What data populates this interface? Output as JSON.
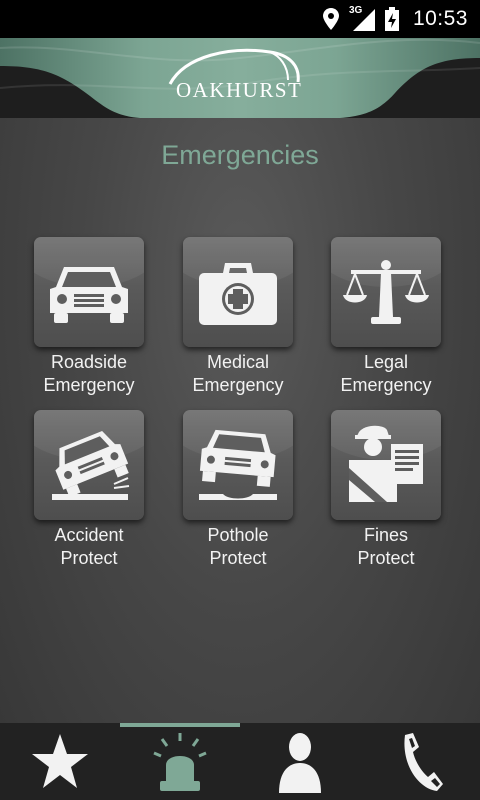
{
  "status_bar": {
    "network": "3G",
    "time": "10:53"
  },
  "header": {
    "logo_text": "OAKHURST"
  },
  "page": {
    "title": "Emergencies"
  },
  "tiles": [
    {
      "line1": "Roadside",
      "line2": "Emergency",
      "icon": "car-icon"
    },
    {
      "line1": "Medical",
      "line2": "Emergency",
      "icon": "medical-kit-icon"
    },
    {
      "line1": "Legal",
      "line2": "Emergency",
      "icon": "scales-icon"
    },
    {
      "line1": "Accident",
      "line2": "Protect",
      "icon": "crashed-car-icon"
    },
    {
      "line1": "Pothole",
      "line2": "Protect",
      "icon": "pothole-car-icon"
    },
    {
      "line1": "Fines",
      "line2": "Protect",
      "icon": "traffic-officer-icon"
    }
  ],
  "bottom_nav": {
    "items": [
      {
        "icon": "star-icon",
        "active": false
      },
      {
        "icon": "siren-icon",
        "active": true
      },
      {
        "icon": "person-icon",
        "active": false
      },
      {
        "icon": "phone-icon",
        "active": false
      }
    ]
  },
  "colors": {
    "accent": "#7fa896",
    "header_green": "#7ca593",
    "background": "#474747",
    "nav_background": "#222222"
  }
}
